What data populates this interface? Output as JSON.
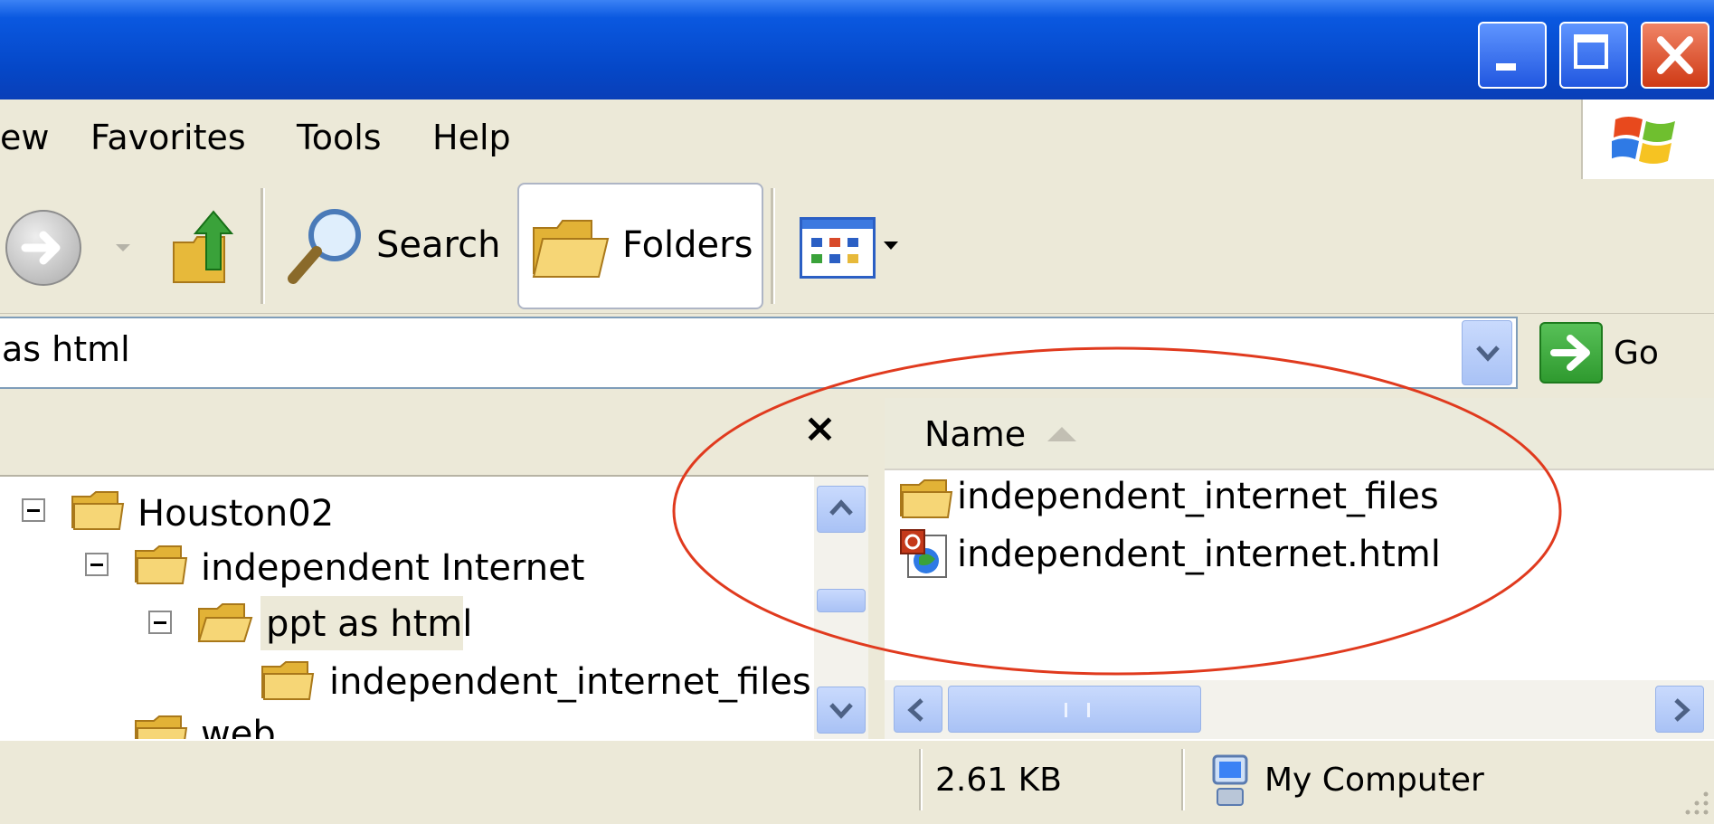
{
  "menu": {
    "items": [
      "ew",
      "Favorites",
      "Tools",
      "Help"
    ]
  },
  "toolbar": {
    "search_label": "Search",
    "folders_label": "Folders"
  },
  "address": {
    "value": "as html",
    "go_label": "Go"
  },
  "tree": {
    "close_glyph": "×",
    "items": [
      {
        "label": "Houston02",
        "expander": "−"
      },
      {
        "label": "independent Internet",
        "expander": "−"
      },
      {
        "label": "ppt as html",
        "expander": "−"
      },
      {
        "label": "independent_internet_files"
      },
      {
        "label": "web"
      }
    ]
  },
  "list": {
    "column_name": "Name",
    "items": [
      {
        "label": "independent_internet_files",
        "icon": "folder-icon"
      },
      {
        "label": "independent_internet.html",
        "icon": "html-document-icon"
      }
    ]
  },
  "status": {
    "size": "2.61 KB",
    "zone": "My Computer"
  },
  "colors": {
    "titlebar": "#0547c7",
    "close": "#cf3a15",
    "annotation_ellipse": "#e03a1e",
    "go": "#2f9a2f"
  }
}
